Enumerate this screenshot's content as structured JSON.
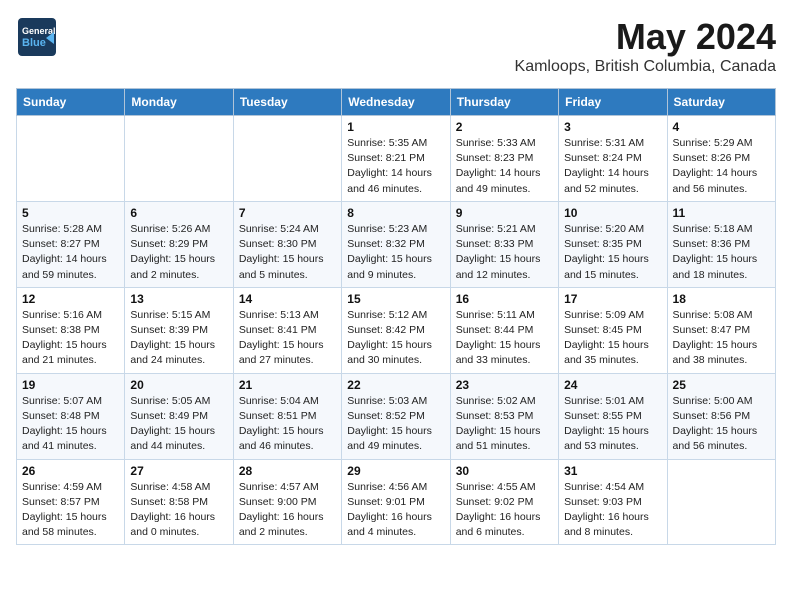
{
  "header": {
    "logo_line1": "General",
    "logo_line2": "Blue",
    "title": "May 2024",
    "subtitle": "Kamloops, British Columbia, Canada"
  },
  "calendar": {
    "days_of_week": [
      "Sunday",
      "Monday",
      "Tuesday",
      "Wednesday",
      "Thursday",
      "Friday",
      "Saturday"
    ],
    "weeks": [
      [
        {
          "day": "",
          "info": ""
        },
        {
          "day": "",
          "info": ""
        },
        {
          "day": "",
          "info": ""
        },
        {
          "day": "1",
          "info": "Sunrise: 5:35 AM\nSunset: 8:21 PM\nDaylight: 14 hours\nand 46 minutes."
        },
        {
          "day": "2",
          "info": "Sunrise: 5:33 AM\nSunset: 8:23 PM\nDaylight: 14 hours\nand 49 minutes."
        },
        {
          "day": "3",
          "info": "Sunrise: 5:31 AM\nSunset: 8:24 PM\nDaylight: 14 hours\nand 52 minutes."
        },
        {
          "day": "4",
          "info": "Sunrise: 5:29 AM\nSunset: 8:26 PM\nDaylight: 14 hours\nand 56 minutes."
        }
      ],
      [
        {
          "day": "5",
          "info": "Sunrise: 5:28 AM\nSunset: 8:27 PM\nDaylight: 14 hours\nand 59 minutes."
        },
        {
          "day": "6",
          "info": "Sunrise: 5:26 AM\nSunset: 8:29 PM\nDaylight: 15 hours\nand 2 minutes."
        },
        {
          "day": "7",
          "info": "Sunrise: 5:24 AM\nSunset: 8:30 PM\nDaylight: 15 hours\nand 5 minutes."
        },
        {
          "day": "8",
          "info": "Sunrise: 5:23 AM\nSunset: 8:32 PM\nDaylight: 15 hours\nand 9 minutes."
        },
        {
          "day": "9",
          "info": "Sunrise: 5:21 AM\nSunset: 8:33 PM\nDaylight: 15 hours\nand 12 minutes."
        },
        {
          "day": "10",
          "info": "Sunrise: 5:20 AM\nSunset: 8:35 PM\nDaylight: 15 hours\nand 15 minutes."
        },
        {
          "day": "11",
          "info": "Sunrise: 5:18 AM\nSunset: 8:36 PM\nDaylight: 15 hours\nand 18 minutes."
        }
      ],
      [
        {
          "day": "12",
          "info": "Sunrise: 5:16 AM\nSunset: 8:38 PM\nDaylight: 15 hours\nand 21 minutes."
        },
        {
          "day": "13",
          "info": "Sunrise: 5:15 AM\nSunset: 8:39 PM\nDaylight: 15 hours\nand 24 minutes."
        },
        {
          "day": "14",
          "info": "Sunrise: 5:13 AM\nSunset: 8:41 PM\nDaylight: 15 hours\nand 27 minutes."
        },
        {
          "day": "15",
          "info": "Sunrise: 5:12 AM\nSunset: 8:42 PM\nDaylight: 15 hours\nand 30 minutes."
        },
        {
          "day": "16",
          "info": "Sunrise: 5:11 AM\nSunset: 8:44 PM\nDaylight: 15 hours\nand 33 minutes."
        },
        {
          "day": "17",
          "info": "Sunrise: 5:09 AM\nSunset: 8:45 PM\nDaylight: 15 hours\nand 35 minutes."
        },
        {
          "day": "18",
          "info": "Sunrise: 5:08 AM\nSunset: 8:47 PM\nDaylight: 15 hours\nand 38 minutes."
        }
      ],
      [
        {
          "day": "19",
          "info": "Sunrise: 5:07 AM\nSunset: 8:48 PM\nDaylight: 15 hours\nand 41 minutes."
        },
        {
          "day": "20",
          "info": "Sunrise: 5:05 AM\nSunset: 8:49 PM\nDaylight: 15 hours\nand 44 minutes."
        },
        {
          "day": "21",
          "info": "Sunrise: 5:04 AM\nSunset: 8:51 PM\nDaylight: 15 hours\nand 46 minutes."
        },
        {
          "day": "22",
          "info": "Sunrise: 5:03 AM\nSunset: 8:52 PM\nDaylight: 15 hours\nand 49 minutes."
        },
        {
          "day": "23",
          "info": "Sunrise: 5:02 AM\nSunset: 8:53 PM\nDaylight: 15 hours\nand 51 minutes."
        },
        {
          "day": "24",
          "info": "Sunrise: 5:01 AM\nSunset: 8:55 PM\nDaylight: 15 hours\nand 53 minutes."
        },
        {
          "day": "25",
          "info": "Sunrise: 5:00 AM\nSunset: 8:56 PM\nDaylight: 15 hours\nand 56 minutes."
        }
      ],
      [
        {
          "day": "26",
          "info": "Sunrise: 4:59 AM\nSunset: 8:57 PM\nDaylight: 15 hours\nand 58 minutes."
        },
        {
          "day": "27",
          "info": "Sunrise: 4:58 AM\nSunset: 8:58 PM\nDaylight: 16 hours\nand 0 minutes."
        },
        {
          "day": "28",
          "info": "Sunrise: 4:57 AM\nSunset: 9:00 PM\nDaylight: 16 hours\nand 2 minutes."
        },
        {
          "day": "29",
          "info": "Sunrise: 4:56 AM\nSunset: 9:01 PM\nDaylight: 16 hours\nand 4 minutes."
        },
        {
          "day": "30",
          "info": "Sunrise: 4:55 AM\nSunset: 9:02 PM\nDaylight: 16 hours\nand 6 minutes."
        },
        {
          "day": "31",
          "info": "Sunrise: 4:54 AM\nSunset: 9:03 PM\nDaylight: 16 hours\nand 8 minutes."
        },
        {
          "day": "",
          "info": ""
        }
      ]
    ]
  }
}
